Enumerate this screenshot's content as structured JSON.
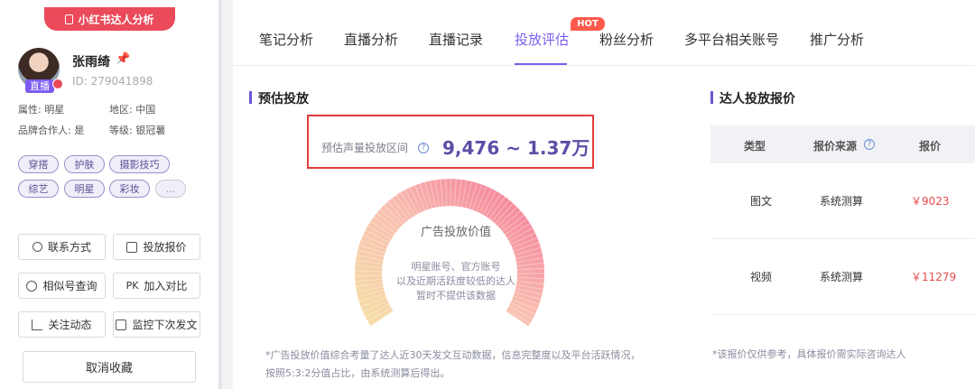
{
  "sidebar": {
    "badge_title": "小红书达人分析",
    "profile": {
      "live_tag": "直播",
      "name": "张雨绮",
      "id_text": "ID: 279041898"
    },
    "attributes": [
      {
        "label": "属性: 明星"
      },
      {
        "label": "地区: 中国"
      },
      {
        "label": "品牌合作人: 是"
      },
      {
        "label": "等级: 银冠薯"
      }
    ],
    "tags": [
      "穿搭",
      "护肤",
      "摄影技巧",
      "综艺",
      "明星",
      "彩妆",
      "..."
    ],
    "buttons": [
      {
        "label": "联系方式",
        "icon": "phone-icon"
      },
      {
        "label": "投放报价",
        "icon": "price-icon"
      },
      {
        "label": "相似号查询",
        "icon": "search-icon"
      },
      {
        "label": "加入对比",
        "icon": "pk-icon",
        "icon_text": "PK"
      },
      {
        "label": "关注动态",
        "icon": "chart-icon"
      },
      {
        "label": "监控下次发文",
        "icon": "monitor-icon"
      }
    ],
    "cancel_label": "取消收藏"
  },
  "tabs": {
    "items": [
      "笔记分析",
      "直播分析",
      "直播记录",
      "投放评估",
      "粉丝分析",
      "多平台相关账号",
      "推广分析"
    ],
    "active": "投放评估",
    "hot_badge": "HOT"
  },
  "estimate": {
    "title": "预估投放",
    "range_label": "预估声量投放区间",
    "range_value": "9,476 ~ 1.37万",
    "gauge_title": "广告投放价值",
    "gauge_notes": [
      "明星账号、官方账号",
      "以及近期活跃度较低的达人",
      "暂时不提供该数据"
    ],
    "footnote": "*广告投放价值综合考量了达人近30天发文互动数据，信息完整度以及平台活跃情况，按照5:3:2分值占比，由系统测算后得出。"
  },
  "pricing": {
    "title": "达人投放报价",
    "headers": [
      "类型",
      "报价来源",
      "报价"
    ],
    "rows": [
      {
        "type": "图文",
        "source": "系统测算",
        "price": "￥9023"
      },
      {
        "type": "视频",
        "source": "系统测算",
        "price": "￥11279"
      }
    ],
    "note": "*该报价仅供参考，具体报价需实际咨询达人"
  },
  "colors": {
    "accent": "#7c5cf0",
    "brand_red": "#ea4a5a",
    "price_red": "#e84b4b",
    "highlight_border": "#e33b3b"
  }
}
